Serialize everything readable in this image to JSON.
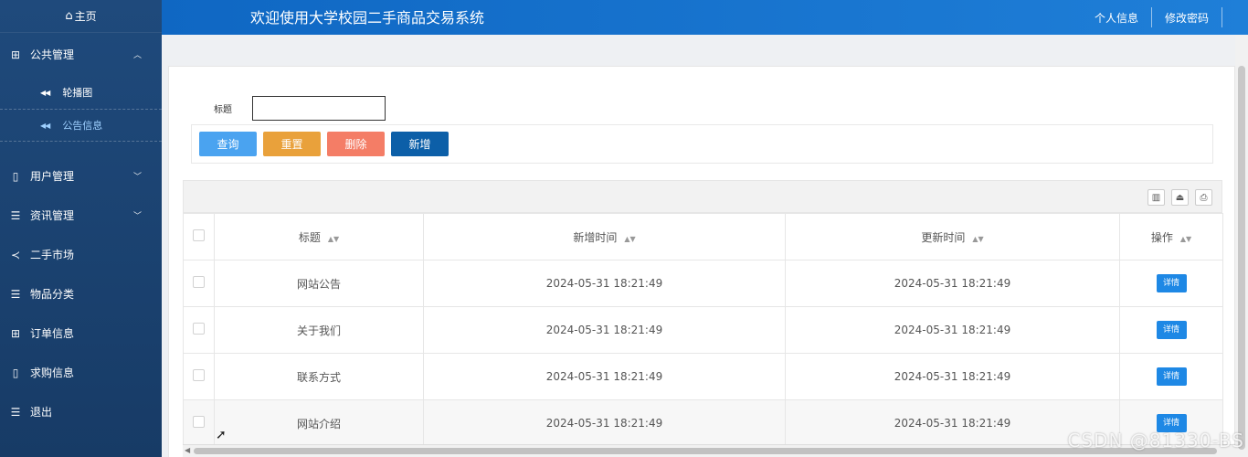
{
  "sidebar": {
    "home": {
      "icon": "home-icon",
      "glyph": "⌂",
      "label": "主页"
    },
    "group": {
      "label": "公共管理",
      "icon": "grid-icon"
    },
    "sub_items": [
      {
        "label": "轮播图",
        "active": false
      },
      {
        "label": "公告信息",
        "active": true
      }
    ],
    "items": [
      {
        "label": "用户管理",
        "icon": "book-icon",
        "expandable": true
      },
      {
        "label": "资讯管理",
        "icon": "list-icon",
        "expandable": true
      },
      {
        "label": "二手市场",
        "icon": "share-icon",
        "expandable": false
      },
      {
        "label": "物品分类",
        "icon": "list-icon",
        "expandable": false
      },
      {
        "label": "订单信息",
        "icon": "grid-icon",
        "expandable": false
      },
      {
        "label": "求购信息",
        "icon": "book-icon",
        "expandable": false
      },
      {
        "label": "退出",
        "icon": "list-icon",
        "expandable": false
      }
    ]
  },
  "header": {
    "title": "欢迎使用大学校园二手商品交易系统",
    "profile_label": "个人信息",
    "password_label": "修改密码"
  },
  "search": {
    "label": "标题",
    "value": "",
    "placeholder": ""
  },
  "buttons": {
    "query": "查询",
    "reset": "重置",
    "delete": "删除",
    "add": "新增"
  },
  "colors": {
    "query": "#4aa3f0",
    "reset": "#e9a13b",
    "delete": "#f47d66",
    "add": "#0c5fa8"
  },
  "table": {
    "columns": [
      "标题",
      "新增时间",
      "更新时间",
      "操作"
    ],
    "detail_label": "详情",
    "rows": [
      {
        "title": "网站公告",
        "created": "2024-05-31 18:21:49",
        "updated": "2024-05-31 18:21:49"
      },
      {
        "title": "关于我们",
        "created": "2024-05-31 18:21:49",
        "updated": "2024-05-31 18:21:49"
      },
      {
        "title": "联系方式",
        "created": "2024-05-31 18:21:49",
        "updated": "2024-05-31 18:21:49"
      },
      {
        "title": "网站介绍",
        "created": "2024-05-31 18:21:49",
        "updated": "2024-05-31 18:21:49"
      }
    ]
  },
  "toolbar": {
    "icons": [
      "columns-icon",
      "export-icon",
      "print-icon"
    ]
  },
  "watermark": "CSDN @81330-BS"
}
